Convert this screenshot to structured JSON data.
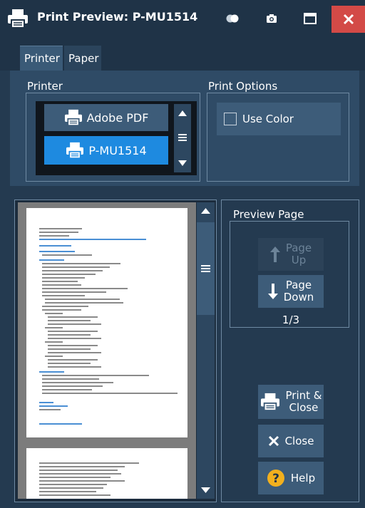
{
  "window": {
    "title": "Print Preview: P-MU1514"
  },
  "tabs": [
    {
      "label": "Printer"
    },
    {
      "label": "Paper"
    }
  ],
  "printer_section": {
    "title": "Printer",
    "printers": [
      {
        "label": "Adobe PDF",
        "selected": false
      },
      {
        "label": "P-MU1514",
        "selected": true
      }
    ]
  },
  "print_options": {
    "title": "Print Options",
    "use_color_label": "Use Color",
    "use_color_checked": false
  },
  "preview_page": {
    "title": "Preview Page",
    "page_up_label_1": "Page",
    "page_up_label_2": "Up",
    "page_down_label_1": "Page",
    "page_down_label_2": "Down",
    "page_indicator": "1/3"
  },
  "actions": {
    "print_close_label_1": "Print &",
    "print_close_label_2": "Close",
    "close_label": "Close",
    "help_label": "Help"
  },
  "colors": {
    "background": "#243a50",
    "selected_printer": "#1e8ae0",
    "button": "#3d5c79",
    "close_button": "#d34a47",
    "help_icon": "#f2b01e"
  }
}
